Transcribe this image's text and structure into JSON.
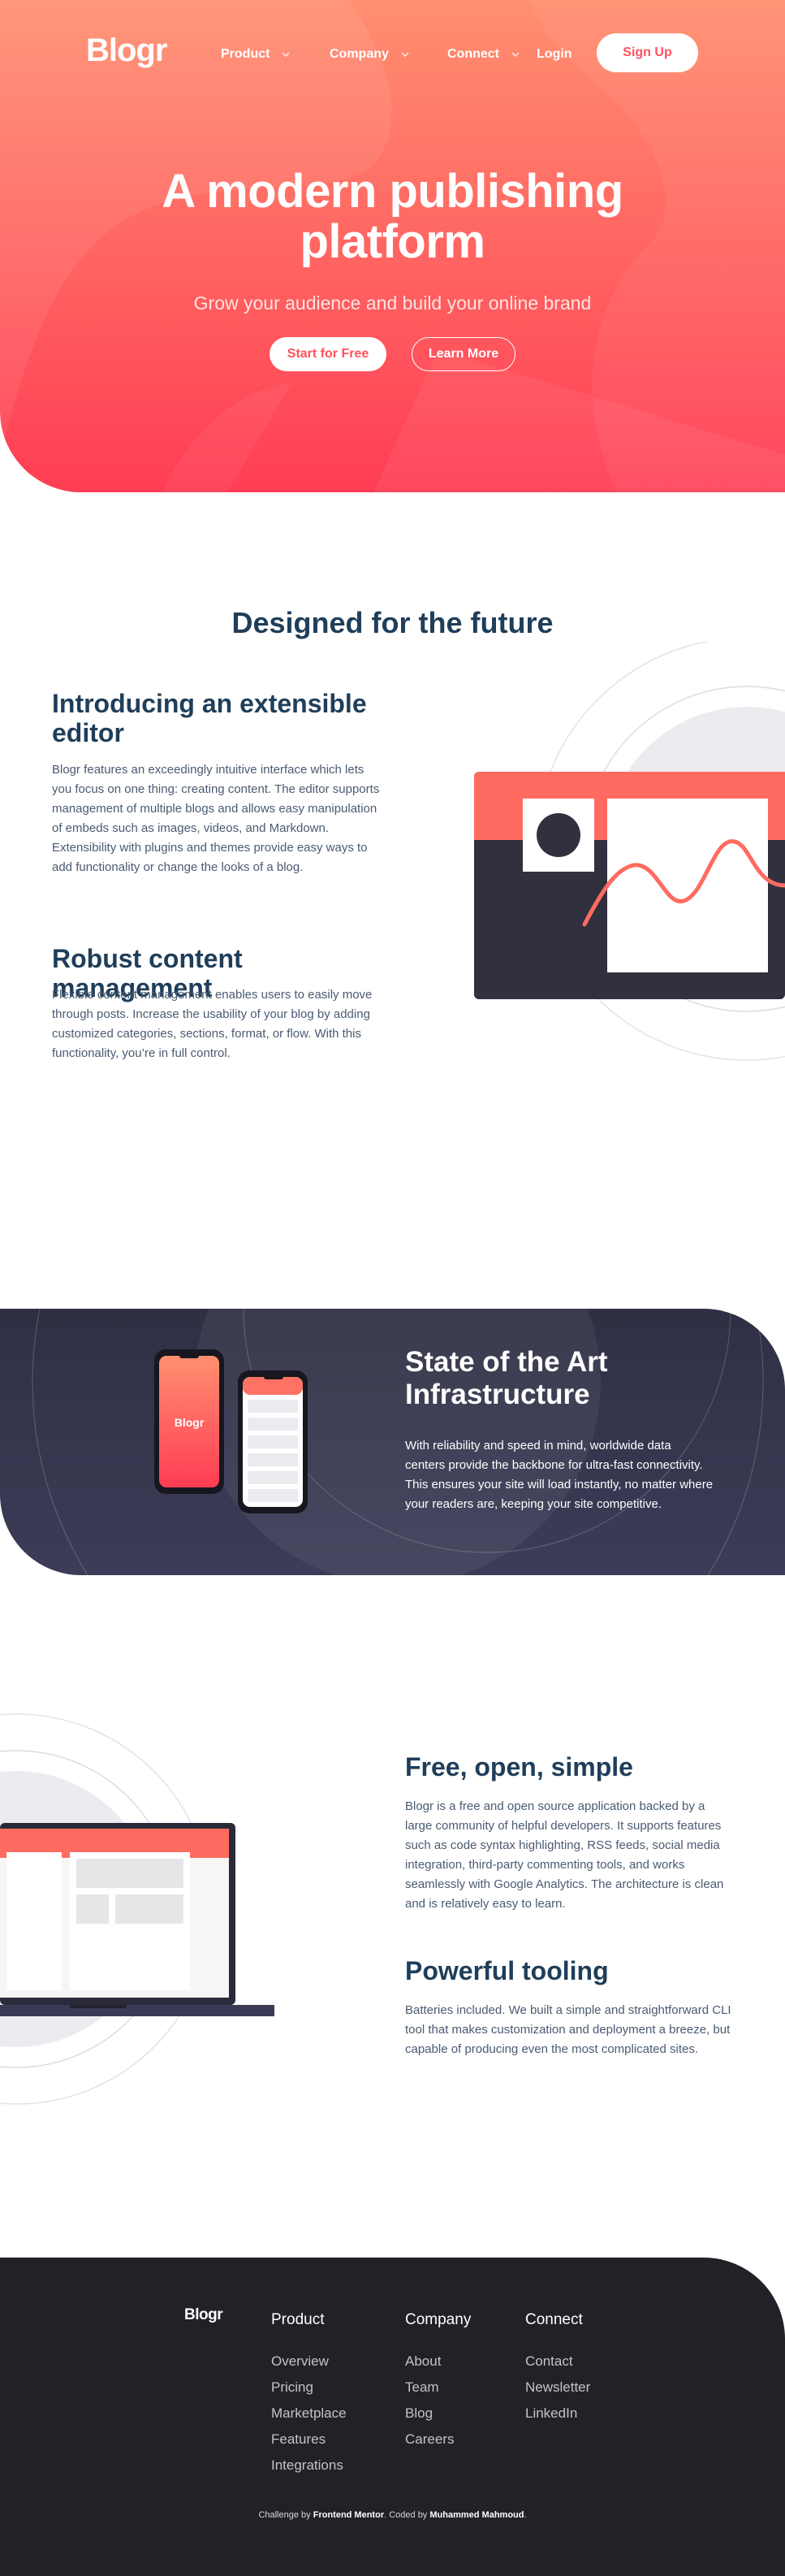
{
  "brand": {
    "logo": "Blogr"
  },
  "nav": {
    "items": [
      {
        "label": "Product",
        "icon": "chevron-down-icon"
      },
      {
        "label": "Company",
        "icon": "chevron-down-icon"
      },
      {
        "label": "Connect",
        "icon": "chevron-down-icon"
      }
    ],
    "login": "Login",
    "signup": "Sign Up"
  },
  "hero": {
    "title": "A modern publishing platform",
    "subtitle": "Grow your audience and build your online brand",
    "primary_cta": "Start for Free",
    "secondary_cta": "Learn More"
  },
  "future": {
    "title": "Designed for the future",
    "features": [
      {
        "heading": "Introducing an extensible editor",
        "text": "Blogr features an exceedingly intuitive interface which lets you focus on one thing: creating content. The editor supports management of multiple blogs and allows easy manipulation of embeds such as images, videos, and Markdown. Extensibility with plugins and themes provide easy ways to add functionality or change the looks of a blog."
      },
      {
        "heading": "Robust content management",
        "text": "Flexible content management enables users to easily move through posts. Increase the usability of your blog by adding customized categories, sections, format, or flow. With this functionality, you’re in full control."
      }
    ]
  },
  "infrastructure": {
    "title": "State of the Art Infrastructure",
    "text": "With reliability and speed in mind, worldwide data centers provide the backbone for ultra-fast connectivity. This ensures your site will load instantly, no matter where your readers are, keeping your site competitive.",
    "phone_brand": "Blogr"
  },
  "free": {
    "features": [
      {
        "heading": "Free, open, simple",
        "text": "Blogr is a free and open source application backed by a large community of helpful developers. It supports features such as code syntax highlighting, RSS feeds, social media integration, third-party commenting tools, and works seamlessly with Google Analytics. The architecture is clean and is relatively easy to learn."
      },
      {
        "heading": "Powerful tooling",
        "text": "Batteries included. We built a simple and straightforward CLI tool that makes customization and deployment a breeze, but capable of producing even the most complicated sites."
      }
    ]
  },
  "footer": {
    "logo": "Blogr",
    "columns": [
      {
        "heading": "Product",
        "links": [
          "Overview",
          "Pricing",
          "Marketplace",
          "Features",
          "Integrations"
        ]
      },
      {
        "heading": "Company",
        "links": [
          "About",
          "Team",
          "Blog",
          "Careers"
        ]
      },
      {
        "heading": "Connect",
        "links": [
          "Contact",
          "Newsletter",
          "LinkedIn"
        ]
      }
    ],
    "credit": {
      "prefix": "Challenge by ",
      "source": "Frontend Mentor",
      "middle": ". Coded by ",
      "author": "Muhammed Mahmoud",
      "suffix": "."
    }
  },
  "colors": {
    "hero_start": "#ff8f70",
    "hero_end": "#ff3d54",
    "primary_text": "#1f3e5a",
    "body_text": "#4a5b72",
    "dark_band": "#3c3c58",
    "footer_bg": "#232127",
    "accent": "#ff525d"
  }
}
